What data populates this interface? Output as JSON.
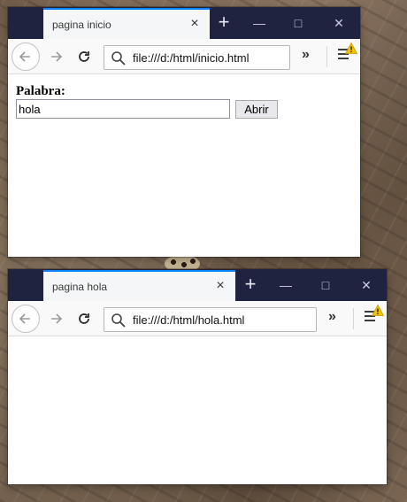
{
  "windows": [
    {
      "tab_title": "pagina inicio",
      "url": "file:///d:/html/inicio.html",
      "form": {
        "label": "Palabra:",
        "input_value": "hola",
        "button_label": "Abrir"
      }
    },
    {
      "tab_title": "pagina hola",
      "url": "file:///d:/html/hola.html"
    }
  ],
  "colors": {
    "titlebar": "#202340",
    "tab_accent": "#0a84ff",
    "warning": "#f2c200"
  },
  "icons": {
    "tab_close": "×",
    "new_tab": "+",
    "minimize": "—",
    "maximize": "□",
    "close": "✕",
    "overflow": "»"
  }
}
